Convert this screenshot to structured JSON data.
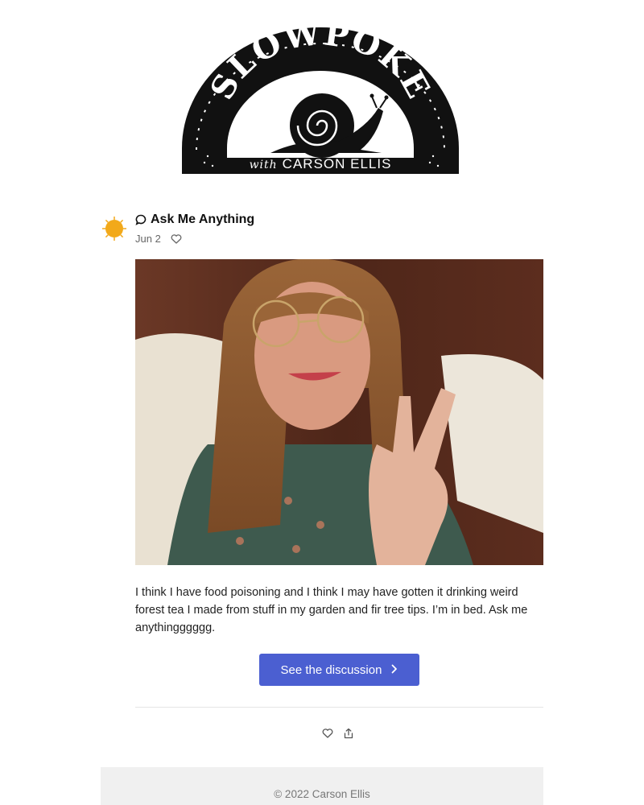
{
  "logo": {
    "title": "SLOWPOKE",
    "subtitle_with": "with",
    "subtitle_name": "CARSON ELLIS"
  },
  "post": {
    "title": "Ask Me Anything",
    "date": "Jun 2",
    "body": "I think I have food poisoning and I think I may have gotten it drinking weird forest tea I made from stuff in my garden and fir tree tips. I’m in bed. Ask me anythingggggg.",
    "cta_label": "See the discussion",
    "icons": {
      "title": "speech-bubble-icon",
      "like": "heart-icon",
      "share": "share-icon",
      "cta": "chevron-right-icon"
    }
  },
  "colors": {
    "accent": "#4b5fd1",
    "avatar": "#f2a91a",
    "footer_bg": "#f0f0f0"
  },
  "footer": {
    "copyright": "© 2022 Carson Ellis"
  }
}
